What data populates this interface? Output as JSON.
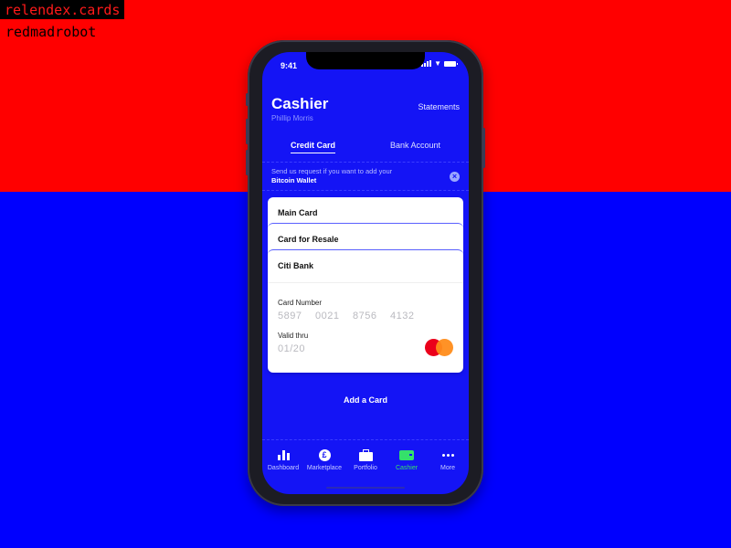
{
  "overlay": {
    "site_label": "relendex.cards",
    "author_label": "redmadrobot"
  },
  "colors": {
    "background_top": "#ff0000",
    "background_bottom": "#0000fe",
    "app_primary": "#1414f5",
    "active_nav": "#35e06b",
    "mastercard_red": "#eb001b",
    "mastercard_orange": "#ff8c1a"
  },
  "status_bar": {
    "time": "9:41",
    "icons": [
      "signal-icon",
      "wifi-icon",
      "battery-icon"
    ]
  },
  "header": {
    "title": "Cashier",
    "subtitle": "Phillip Morris",
    "statements_link": "Statements"
  },
  "tabs": [
    {
      "label": "Credit Card",
      "active": true
    },
    {
      "label": "Bank Account",
      "active": false
    }
  ],
  "banner": {
    "message": "Send us request if you want to add your",
    "highlight": "Bitcoin Wallet",
    "close_icon": "close-icon"
  },
  "cards": [
    {
      "name": "Main Card"
    },
    {
      "name": "Card for Resale"
    },
    {
      "name": "Citi Bank",
      "card_number_label": "Card Number",
      "card_number_groups": [
        "5897",
        "0021",
        "8756",
        "4132"
      ],
      "valid_thru_label": "Valid thru",
      "valid_thru": "01/20",
      "brand_icon": "mastercard-icon"
    }
  ],
  "add_card_label": "Add a Card",
  "nav": [
    {
      "label": "Dashboard",
      "icon": "bar-chart-icon",
      "active": false
    },
    {
      "label": "Marketplace",
      "icon": "pound-icon",
      "active": false
    },
    {
      "label": "Portfolio",
      "icon": "briefcase-icon",
      "active": false
    },
    {
      "label": "Cashier",
      "icon": "wallet-icon",
      "active": true
    },
    {
      "label": "More",
      "icon": "more-icon",
      "active": false
    }
  ]
}
